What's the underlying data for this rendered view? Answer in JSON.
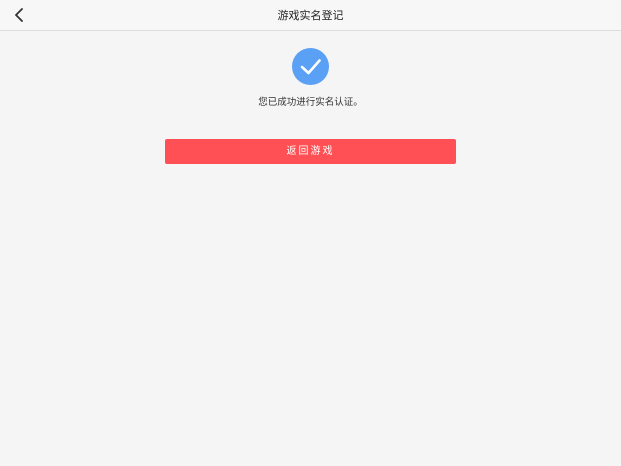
{
  "header": {
    "title": "游戏实名登记",
    "back_icon": "chevron-left-icon"
  },
  "main": {
    "status_icon": "checkmark-circle-icon",
    "message": "您已成功进行实名认证。",
    "return_button_label": "返回游戏"
  },
  "colors": {
    "accent_blue": "#5aa0f5",
    "button_red": "#ff5155",
    "background": "#f5f5f5"
  }
}
